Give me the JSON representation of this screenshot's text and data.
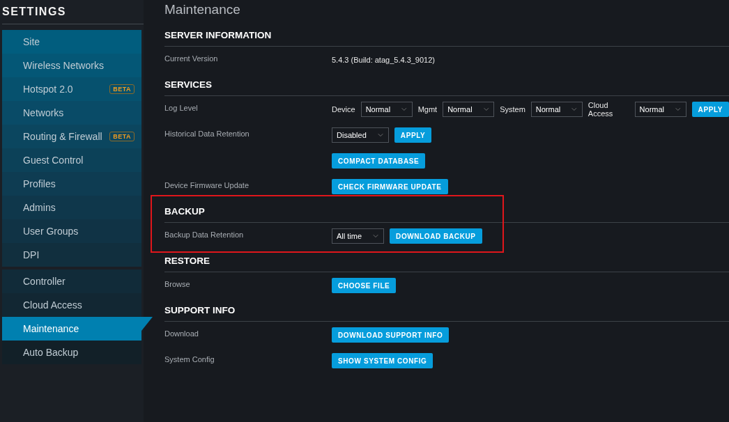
{
  "sidebar": {
    "title": "SETTINGS",
    "groups": [
      {
        "items": [
          {
            "label": "Site",
            "selected": false
          },
          {
            "label": "Wireless Networks",
            "selected": false
          },
          {
            "label": "Hotspot 2.0",
            "selected": false,
            "badge": "BETA"
          },
          {
            "label": "Networks",
            "selected": false
          },
          {
            "label": "Routing & Firewall",
            "selected": false,
            "badge": "BETA"
          },
          {
            "label": "Guest Control",
            "selected": false
          },
          {
            "label": "Profiles",
            "selected": false
          },
          {
            "label": "Admins",
            "selected": false
          },
          {
            "label": "User Groups",
            "selected": false
          },
          {
            "label": "DPI",
            "selected": false
          }
        ]
      },
      {
        "items": [
          {
            "label": "Controller",
            "selected": false
          },
          {
            "label": "Cloud Access",
            "selected": false
          },
          {
            "label": "Maintenance",
            "selected": true
          },
          {
            "label": "Auto Backup",
            "selected": false
          }
        ]
      }
    ]
  },
  "main": {
    "title": "Maintenance",
    "sections": [
      {
        "heading": "SERVER INFORMATION",
        "highlighted": false,
        "rows": [
          {
            "label": "Current Version",
            "controls": [
              {
                "kind": "text",
                "text": "5.4.3 (Build: atag_5.4.3_9012)"
              }
            ]
          }
        ]
      },
      {
        "heading": "SERVICES",
        "highlighted": false,
        "rows": [
          {
            "label": "Log Level",
            "controls": [
              {
                "kind": "label",
                "text": "Device"
              },
              {
                "kind": "select",
                "value": "Normal"
              },
              {
                "kind": "label",
                "text": "Mgmt"
              },
              {
                "kind": "select",
                "value": "Normal"
              },
              {
                "kind": "label",
                "text": "System"
              },
              {
                "kind": "select",
                "value": "Normal"
              },
              {
                "kind": "label",
                "text": "Cloud Access"
              },
              {
                "kind": "select",
                "value": "Normal"
              },
              {
                "kind": "button",
                "text": "APPLY"
              }
            ]
          },
          {
            "label": "Historical Data Retention",
            "controls": [
              {
                "kind": "select",
                "value": "Disabled"
              },
              {
                "kind": "button",
                "text": "APPLY"
              }
            ]
          },
          {
            "controls": [
              {
                "kind": "button",
                "text": "COMPACT DATABASE"
              }
            ]
          },
          {
            "label": "Device Firmware Update",
            "controls": [
              {
                "kind": "button",
                "text": "CHECK FIRMWARE UPDATE"
              }
            ]
          }
        ]
      },
      {
        "heading": "BACKUP",
        "highlighted": true,
        "rows": [
          {
            "label": "Backup Data Retention",
            "controls": [
              {
                "kind": "select",
                "value": "All time"
              },
              {
                "kind": "button",
                "text": "DOWNLOAD BACKUP"
              }
            ]
          }
        ]
      },
      {
        "heading": "RESTORE",
        "highlighted": false,
        "rows": [
          {
            "label": "Browse",
            "controls": [
              {
                "kind": "button",
                "text": "CHOOSE FILE"
              }
            ]
          }
        ]
      },
      {
        "heading": "SUPPORT INFO",
        "highlighted": false,
        "rows": [
          {
            "label": "Download",
            "controls": [
              {
                "kind": "button",
                "text": "DOWNLOAD SUPPORT INFO"
              }
            ]
          },
          {
            "label": "System Config",
            "controls": [
              {
                "kind": "button",
                "text": "SHOW SYSTEM CONFIG"
              }
            ]
          }
        ]
      }
    ]
  }
}
